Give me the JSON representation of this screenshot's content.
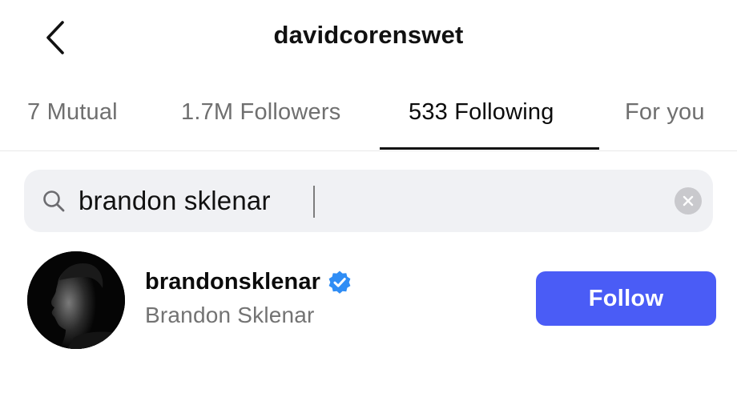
{
  "header": {
    "title": "davidcorenswet",
    "back_icon": "chevron-left-icon"
  },
  "tabs": [
    {
      "label": "7 Mutual",
      "active": false
    },
    {
      "label": "1.7M Followers",
      "active": false
    },
    {
      "label": "533 Following",
      "active": true
    },
    {
      "label": "For you",
      "active": false
    }
  ],
  "search": {
    "value": "brandon sklenar",
    "icon": "search-icon",
    "clear_icon": "clear-icon"
  },
  "results": [
    {
      "username": "brandonsklenar",
      "full_name": "Brandon Sklenar",
      "verified": true,
      "follow_label": "Follow"
    }
  ],
  "colors": {
    "accent": "#4a5cf6",
    "verified": "#2f8df5",
    "muted_text": "#737373",
    "search_bg": "#f0f1f4"
  }
}
